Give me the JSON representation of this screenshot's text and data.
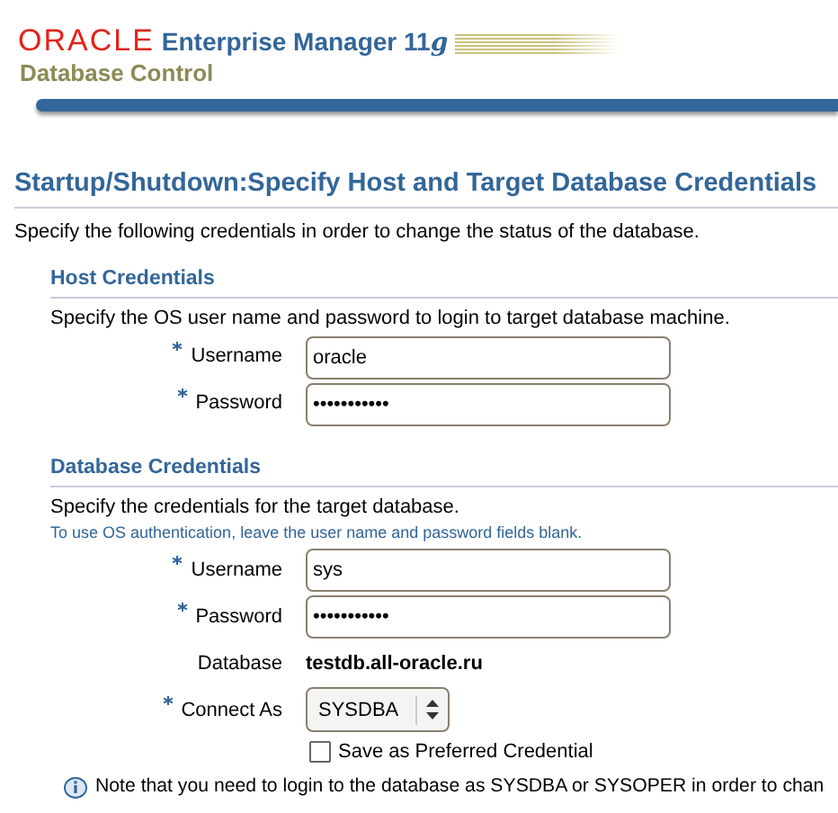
{
  "header": {
    "brand": "ORACLE",
    "product": "Enterprise Manager 11",
    "version": "g",
    "subtitle": "Database Control"
  },
  "page_title": "Startup/Shutdown:Specify Host and Target Database Credentials",
  "description": "Specify the following credentials in order to change the status of the database.",
  "sections": [
    {
      "title": "Host Credentials",
      "description": "Specify the OS user name and password to login to target database machine.",
      "fields": [
        {
          "kind": "text",
          "label": "Username",
          "required": true,
          "value": "oracle"
        },
        {
          "kind": "text",
          "label": "Password",
          "required": true,
          "value": "•••••••••••"
        }
      ]
    },
    {
      "title": "Database Credentials",
      "description": "Specify the credentials for the target database.",
      "hint": "To use OS authentication, leave the user name and password fields blank.",
      "fields": [
        {
          "kind": "text",
          "label": "Username",
          "required": true,
          "value": "sys"
        },
        {
          "kind": "text",
          "label": "Password",
          "required": true,
          "value": "•••••••••••"
        },
        {
          "kind": "static",
          "label": "Database",
          "required": false,
          "value": "testdb.all-oracle.ru"
        },
        {
          "kind": "select",
          "label": "Connect As",
          "required": true,
          "value": "SYSDBA"
        },
        {
          "kind": "checkbox",
          "label": "Save as Preferred Credential",
          "checked": false
        }
      ]
    }
  ],
  "note": "Note that you need to login to the database as SYSDBA or SYSOPER in order to chan"
}
